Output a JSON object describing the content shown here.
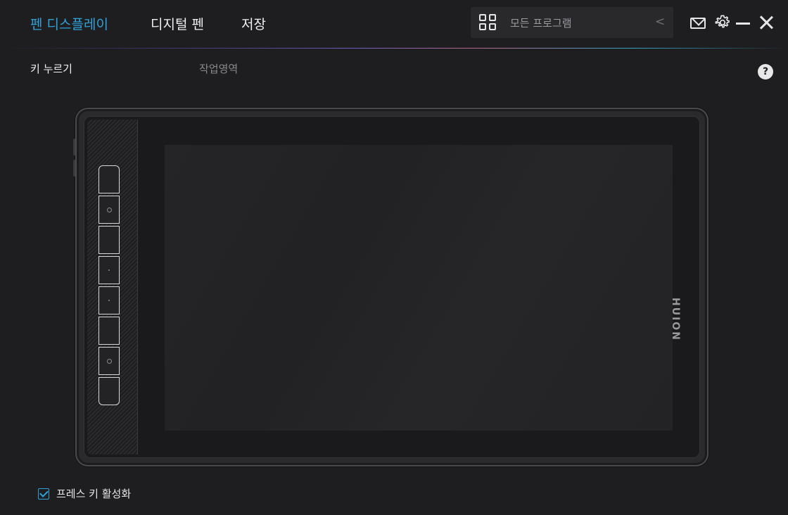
{
  "nav": {
    "tabs": [
      {
        "label": "펜 디스플레이",
        "active": true
      },
      {
        "label": "디지털 펜",
        "active": false
      },
      {
        "label": "저장",
        "active": false
      }
    ]
  },
  "program_select": {
    "value": "모든 프로그램",
    "icon": "grid-icon"
  },
  "window_controls": {
    "icons": [
      "mail-icon",
      "gear-icon",
      "minimize-icon",
      "close-icon"
    ]
  },
  "subtabs": [
    {
      "label": "키 누르기",
      "active": true
    },
    {
      "label": "작업영역",
      "active": false
    }
  ],
  "help": {
    "label": "?"
  },
  "tablet": {
    "brand": "HUION",
    "express_keys": [
      {
        "mark": "none"
      },
      {
        "mark": "ring"
      },
      {
        "mark": "none"
      },
      {
        "mark": "dot"
      },
      {
        "mark": "dot"
      },
      {
        "mark": "none"
      },
      {
        "mark": "ring"
      },
      {
        "mark": "none"
      }
    ]
  },
  "express_key_toggle": {
    "label": "프레스 키 활성화",
    "checked": true
  },
  "colors": {
    "accent": "#2fa3d9",
    "background": "#1e1e20"
  }
}
